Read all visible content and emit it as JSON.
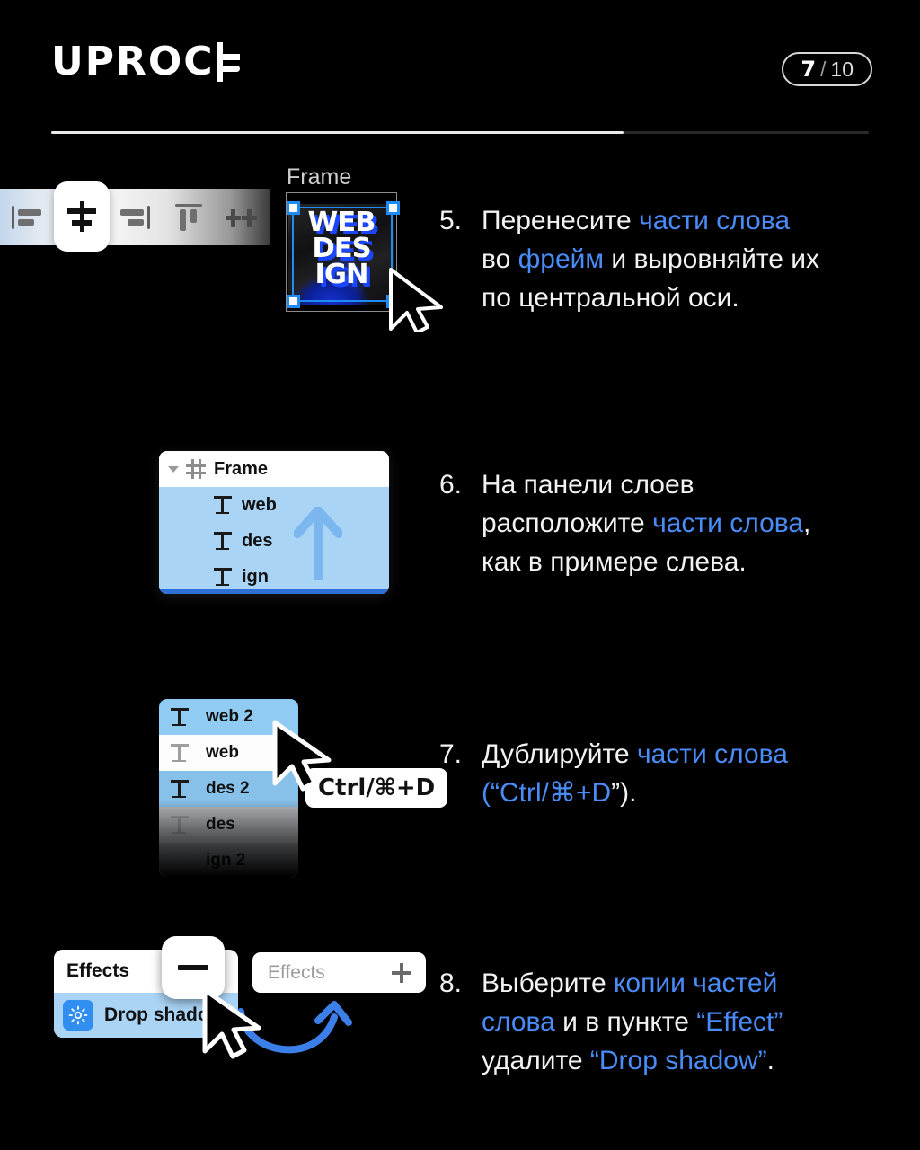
{
  "header": {
    "logo_text": "UPROC",
    "logo_alt": "UPROCK",
    "counter_current": "7",
    "counter_separator": "/",
    "counter_total": "10",
    "progress_percent": 70
  },
  "steps": [
    {
      "number": "5.",
      "line1_a": "Перенесите ",
      "line1_b": "части слова",
      "line2_a": "во ",
      "line2_b": "фрейм",
      "line2_c": " и выровняйте их",
      "line3": "по центральной оси."
    },
    {
      "number": "6.",
      "line1": "На панели слоев",
      "line2_a": "расположите ",
      "line2_b": "части слова",
      "line2_c": ",",
      "line3": "как в примере слева."
    },
    {
      "number": "7.",
      "line1_a": "Дублируйте ",
      "line1_b": "части слова",
      "line2_a": "(“",
      "line2_b": "Ctrl/⌘+D",
      "line2_c": "”)."
    },
    {
      "number": "8.",
      "line1_a": "Выберите ",
      "line1_b": "копии частей",
      "line2_a": "слова",
      "line2_b": " и в пункте ",
      "line2_c": "“Effect”",
      "line3_a": "удалите ",
      "line3_b": "“Drop shadow”",
      "line3_c": "."
    }
  ],
  "toolbar": {
    "icons": [
      {
        "name": "align-left",
        "active": false
      },
      {
        "name": "align-horizontal-centers",
        "active": true
      },
      {
        "name": "align-right",
        "active": false
      },
      {
        "name": "align-top",
        "active": false
      },
      {
        "name": "distribute-horizontal",
        "active": false
      }
    ]
  },
  "frame_thumb": {
    "label": "Frame",
    "art_line1": "WEB",
    "art_line2": "DES",
    "art_line3": "IGN"
  },
  "layers_panel_6": {
    "root_label": "Frame",
    "children": [
      "web",
      "des",
      "ign"
    ]
  },
  "layers_panel_7": {
    "rows": [
      {
        "label": "web 2",
        "state": "selected"
      },
      {
        "label": "web",
        "state": "normal"
      },
      {
        "label": "des 2",
        "state": "selected"
      },
      {
        "label": "des",
        "state": "dim"
      },
      {
        "label": "ign 2",
        "state": "dim"
      }
    ],
    "shortcut_tooltip": "Ctrl/⌘+D"
  },
  "effects_panel_before": {
    "title": "Effects",
    "effect_name": "Drop shadow",
    "remove_button": "−"
  },
  "effects_panel_after": {
    "title": "Effects",
    "add_button": "+"
  },
  "colors": {
    "background": "#000000",
    "text": "#f2f2f2",
    "accent_blue": "#4a8cf7",
    "selection_blue": "#a9d4f6",
    "figma_blue": "#1f8cf5",
    "panel_white": "#ffffff"
  }
}
